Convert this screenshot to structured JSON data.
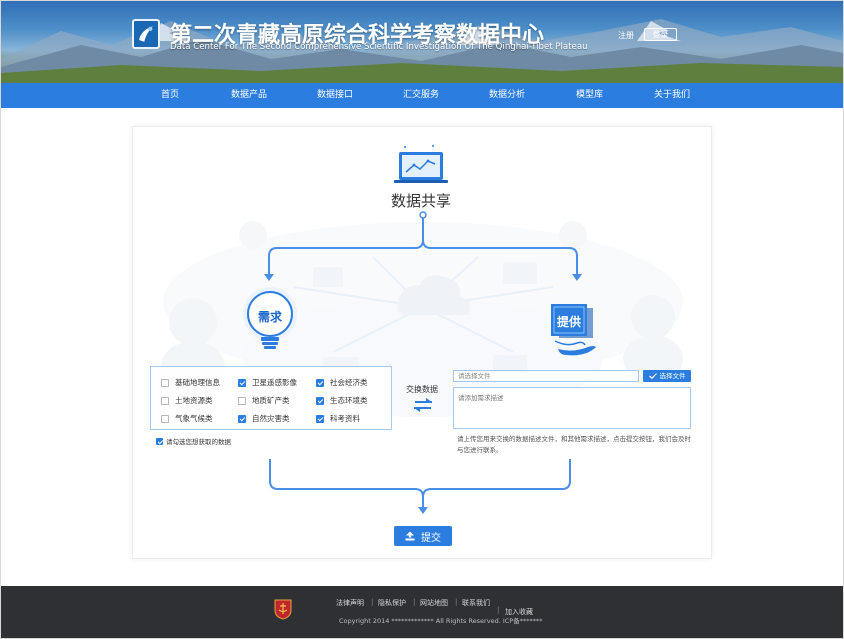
{
  "header": {
    "title_cn": "第二次青藏高原综合科学考察数据中心",
    "title_en": "Data Center For The Second Comprehensive Scientific Investigation Of The Qinghai-Tibet Plateau",
    "register": "注册",
    "login": "登录"
  },
  "nav": {
    "items": [
      "首页",
      "数据产品",
      "数据接口",
      "汇交服务",
      "数据分析",
      "模型库",
      "关于我们"
    ]
  },
  "main": {
    "title": "数据共享",
    "demand_label": "需求",
    "supply_label": "提供",
    "exchange_label": "交换数据",
    "checkboxes": [
      {
        "label": "基础地理信息",
        "checked": false
      },
      {
        "label": "卫星遥感影像",
        "checked": true
      },
      {
        "label": "社会经济类",
        "checked": true
      },
      {
        "label": "土地资源类",
        "checked": false
      },
      {
        "label": "地质矿产类",
        "checked": false
      },
      {
        "label": "生态环境类",
        "checked": true
      },
      {
        "label": "气象气候类",
        "checked": false
      },
      {
        "label": "自然灾害类",
        "checked": true
      },
      {
        "label": "科考资料",
        "checked": true
      }
    ],
    "consent": "请勾选您想获取的数据",
    "file_placeholder": "请选择文件",
    "choose_file": "选择文件",
    "desc_placeholder": "请添加需求描述",
    "hint": "请上传您用来交换的数据描述文件，和其他需求描述，点击提交按钮，我们会及时与您进行联系。",
    "submit": "提交"
  },
  "footer": {
    "links": [
      "法律声明",
      "隐私保护",
      "网站地图",
      "联系我们"
    ],
    "favorite": "加入收藏",
    "copyright": "Copyright 2014 ************* All Rights Reserved. ICP备*******"
  },
  "colors": {
    "primary": "#2c7de0",
    "footer": "#2e3033",
    "title_blue": "#1b67c9"
  }
}
